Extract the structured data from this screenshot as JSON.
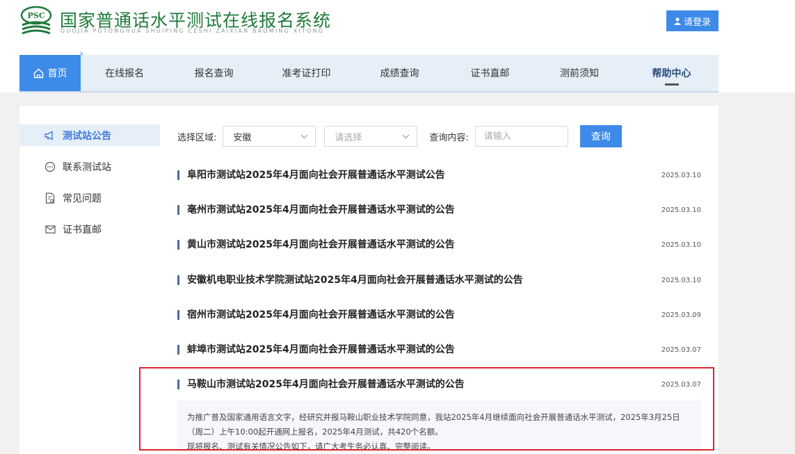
{
  "header": {
    "logo_text": "PSC",
    "title": "国家普通话水平测试在线报名系统",
    "subtitle": "GUOJIA PUTONGHUA SHUIPING CESHI ZAIXIAN BAOMING XITONG",
    "login_label": "请登录"
  },
  "nav": {
    "items": [
      "首页",
      "在线报名",
      "报名查询",
      "准考证打印",
      "成绩查询",
      "证书直邮",
      "测前须知",
      "帮助中心"
    ]
  },
  "sidebar": {
    "items": [
      {
        "label": "测试站公告",
        "icon": "megaphone-icon"
      },
      {
        "label": "联系测试站",
        "icon": "chat-icon"
      },
      {
        "label": "常见问题",
        "icon": "document-question-icon"
      },
      {
        "label": "证书直邮",
        "icon": "mail-icon"
      }
    ]
  },
  "filter": {
    "region_label": "选择区域:",
    "region_value": "安徽",
    "sub_region_placeholder": "请选择",
    "query_label": "查询内容:",
    "query_placeholder": "请输入",
    "query_button": "查询"
  },
  "announcements": [
    {
      "title": "阜阳市测试站2025年4月面向社会开展普通话水平测试公告",
      "date": "2025.03.10"
    },
    {
      "title": "亳州市测试站2025年4月面向社会开展普通话水平测试的公告",
      "date": "2025.03.10"
    },
    {
      "title": "黄山市测试站2025年4月面向社会开展普通话水平测试的公告",
      "date": "2025.03.10"
    },
    {
      "title": "安徽机电职业技术学院测试站2025年4月面向社会开展普通话水平测试的公告",
      "date": "2025.03.10"
    },
    {
      "title": "宿州市测试站2025年4月面向社会开展普通话水平测试的公告",
      "date": "2025.03.09"
    },
    {
      "title": "蚌埠市测试站2025年4月面向社会开展普通话水平测试的公告",
      "date": "2025.03.07"
    },
    {
      "title": "马鞍山市测试站2025年4月面向社会开展普通话水平测试的公告",
      "date": "2025.03.07"
    }
  ],
  "detail": {
    "line1": "为推广普及国家通用语言文字，经研究并报马鞍山职业技术学院同意，我站2025年4月继续面向社会开展普通话水平测试，2025年3月25日（周二）上午10:00起开通网上报名，2025年4月测试，共420个名额。",
    "line2": "现将报名、测试有关情况公告如下，请广大考生务必认真、完整阅读。"
  },
  "colors": {
    "brand_green": "#1f7a3a",
    "accent_blue": "#3d8ae8",
    "highlight_red": "#d9232d"
  }
}
